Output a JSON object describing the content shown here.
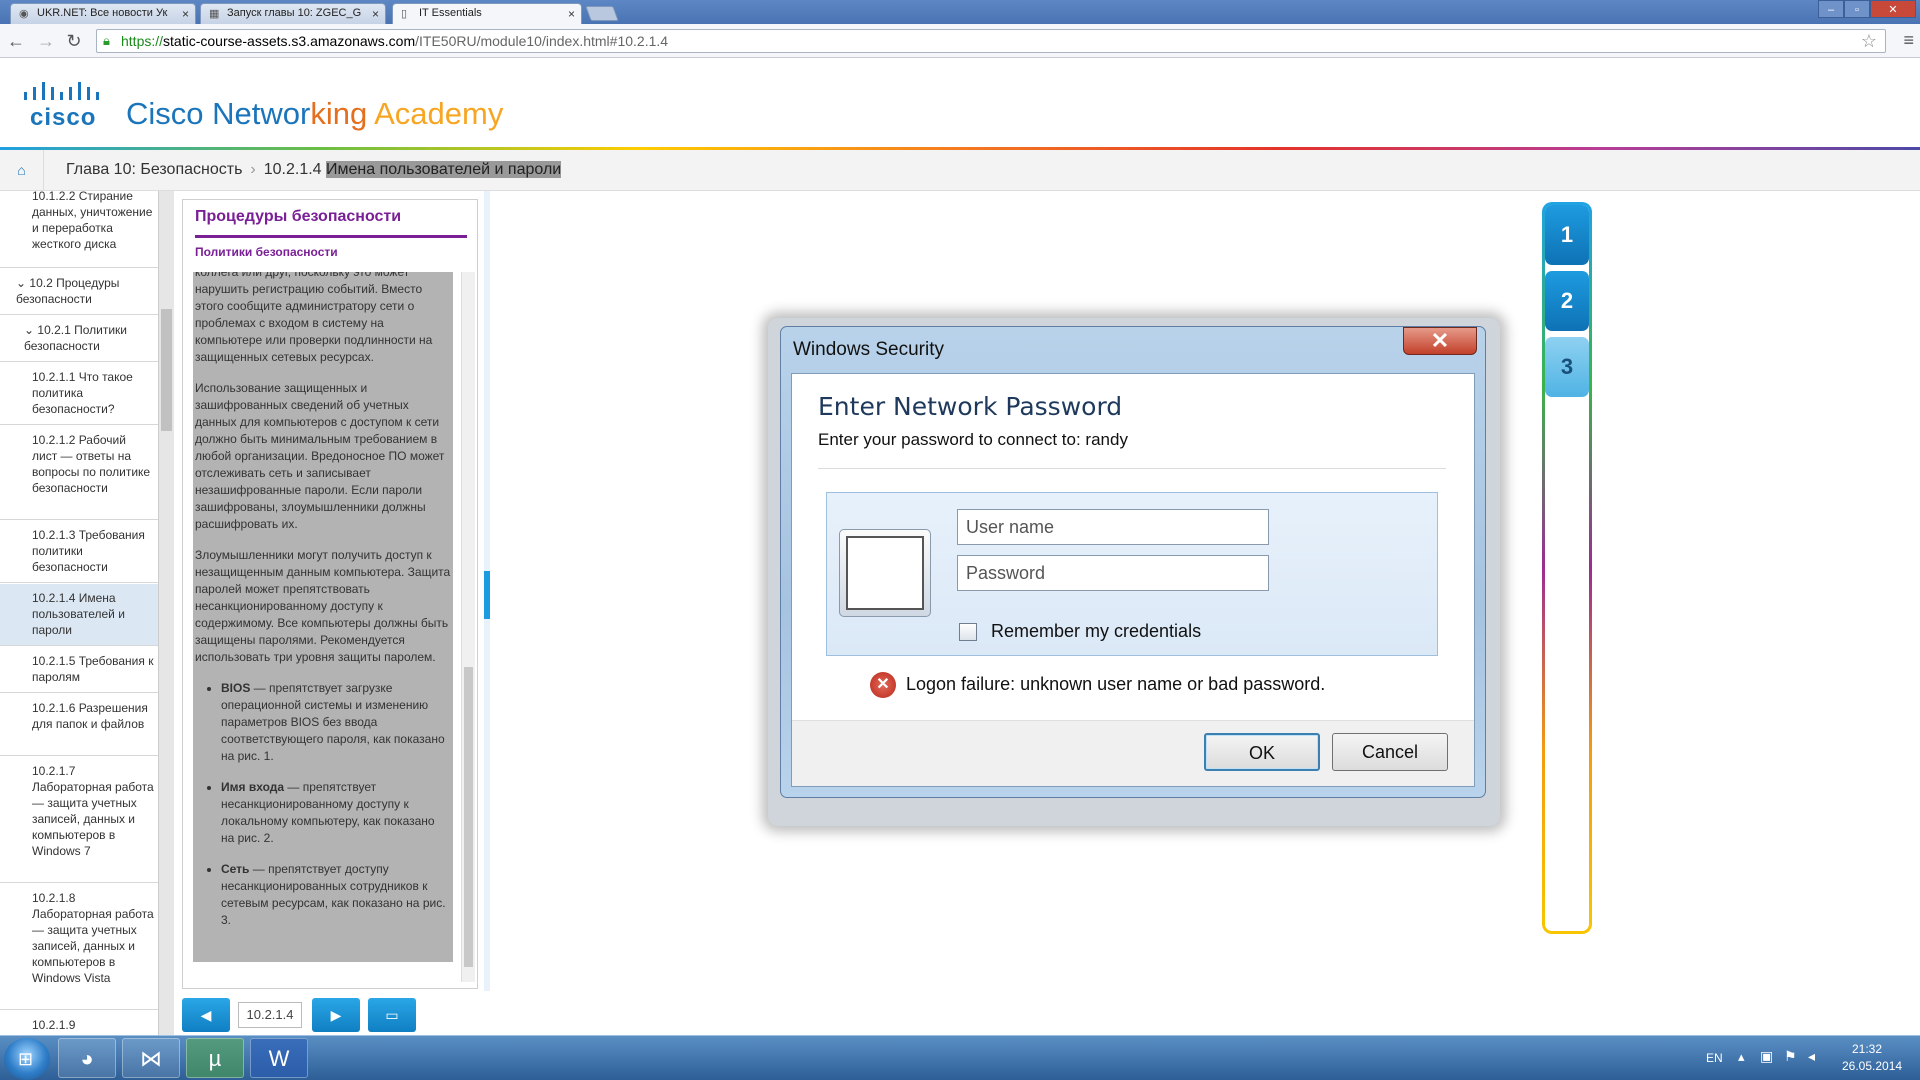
{
  "browser": {
    "tabs": [
      {
        "label": "UKR.NET: Все новости Ук",
        "favicon": "globe-icon"
      },
      {
        "label": "Запуск главы 10: ZGEC_G",
        "favicon": "grid-icon"
      },
      {
        "label": "IT Essentials",
        "favicon": "page-icon"
      }
    ],
    "url": {
      "scheme": "https://",
      "host": "static-course-assets.s3.amazonaws.com",
      "path": "/ITE50RU/module10/index.html#10.2.1.4"
    }
  },
  "header": {
    "logo_word": "cisco",
    "academy_parts": [
      "Cisco Networ",
      "ki",
      "ng ",
      "Academy"
    ]
  },
  "breadcrumb": {
    "chapter": "Глава 10: Безопасность",
    "separator": "›",
    "section_num": "10.2.1.4",
    "section_title": "Имена пользователей и пароли"
  },
  "sidebar": {
    "items": [
      {
        "label": "10.1.2.2 Стирание данных, уничтожение и переработка жесткого диска",
        "level": 3
      },
      {
        "label": "10.2 Процедуры безопасности",
        "level": 1
      },
      {
        "label": "10.2.1 Политики безопасности",
        "level": 2
      },
      {
        "label": "10.2.1.1 Что такое политика безопасности?",
        "level": 3
      },
      {
        "label": "10.2.1.2 Рабочий лист — ответы на вопросы по политике безопасности",
        "level": 3
      },
      {
        "label": "10.2.1.3 Требования политики безопасности",
        "level": 3
      },
      {
        "label": "10.2.1.4 Имена пользователей и пароли",
        "level": 3,
        "active": true
      },
      {
        "label": "10.2.1.5 Требования к паролям",
        "level": 3
      },
      {
        "label": "10.2.1.6 Разрешения для папок и файлов",
        "level": 3
      },
      {
        "label": "10.2.1.7 Лабораторная работа — защита учетных записей, данных и компьютеров в Windows 7",
        "level": 3
      },
      {
        "label": "10.2.1.8 Лабораторная работа — защита учетных записей, данных и компьютеров в Windows Vista",
        "level": 3
      },
      {
        "label": "10.2.1.9",
        "level": 3
      }
    ]
  },
  "content": {
    "title": "Процедуры безопасности",
    "subtitle": "Политики безопасности",
    "p0": "коллега или друг, поскольку это может нарушить регистрацию событий. Вместо этого сообщите администратору сети о проблемах с входом в систему на компьютере или проверки подлинности на защищенных сетевых ресурсах.",
    "p1": "Использование защищенных и зашифрованных сведений об учетных данных для компьютеров с доступом к сети должно быть минимальным требованием в любой организации. Вредоносное ПО может отслеживать сеть и записывает незашифрованные пароли. Если пароли зашифрованы, злоумышленники должны расшифровать их.",
    "p2": "Злоумышленники могут получить доступ к незащищенным данным компьютера. Защита паролей может препятствовать несанкционированному доступу к содержимому. Все компьютеры должны быть защищены паролями. Рекомендуется использовать три уровня защиты паролем.",
    "bullets": [
      {
        "term": "BIOS",
        "text": " — препятствует загрузке операционной системы и изменению параметров BIOS без ввода соответствующего пароля, как показано на рис. 1."
      },
      {
        "term": "Имя входа",
        "text": " — препятствует несанкционированному доступу к локальному компьютеру, как показано на рис. 2."
      },
      {
        "term": "Сеть",
        "text": " — препятствует доступу несанкционированных сотрудников к сетевым ресурсам, как показано на рис. 3."
      }
    ]
  },
  "bottom_nav": {
    "page_field": "10.2.1.4"
  },
  "figure_nav": [
    "1",
    "2",
    "3"
  ],
  "dialog": {
    "window_title": "Windows Security",
    "close_glyph": "✕",
    "heading": "Enter Network Password",
    "subheading": "Enter your password to connect to: randy",
    "username_placeholder": "User name",
    "password_placeholder": "Password",
    "remember_label": "Remember my credentials",
    "remember_checked": false,
    "error_glyph": "✕",
    "error_text": "Logon failure: unknown user name or bad password.",
    "ok_label": "OK",
    "cancel_label": "Cancel"
  },
  "taskbar": {
    "apps": [
      "chrome-icon",
      "visual-studio-icon",
      "utorrent-icon",
      "word-icon"
    ],
    "lang": "EN",
    "time": "21:32",
    "date": "26.05.2014"
  },
  "colors": {
    "cisco_blue": "#1b75bb",
    "purple": "#7a1f96",
    "accent_blue": "#1b9be0"
  }
}
